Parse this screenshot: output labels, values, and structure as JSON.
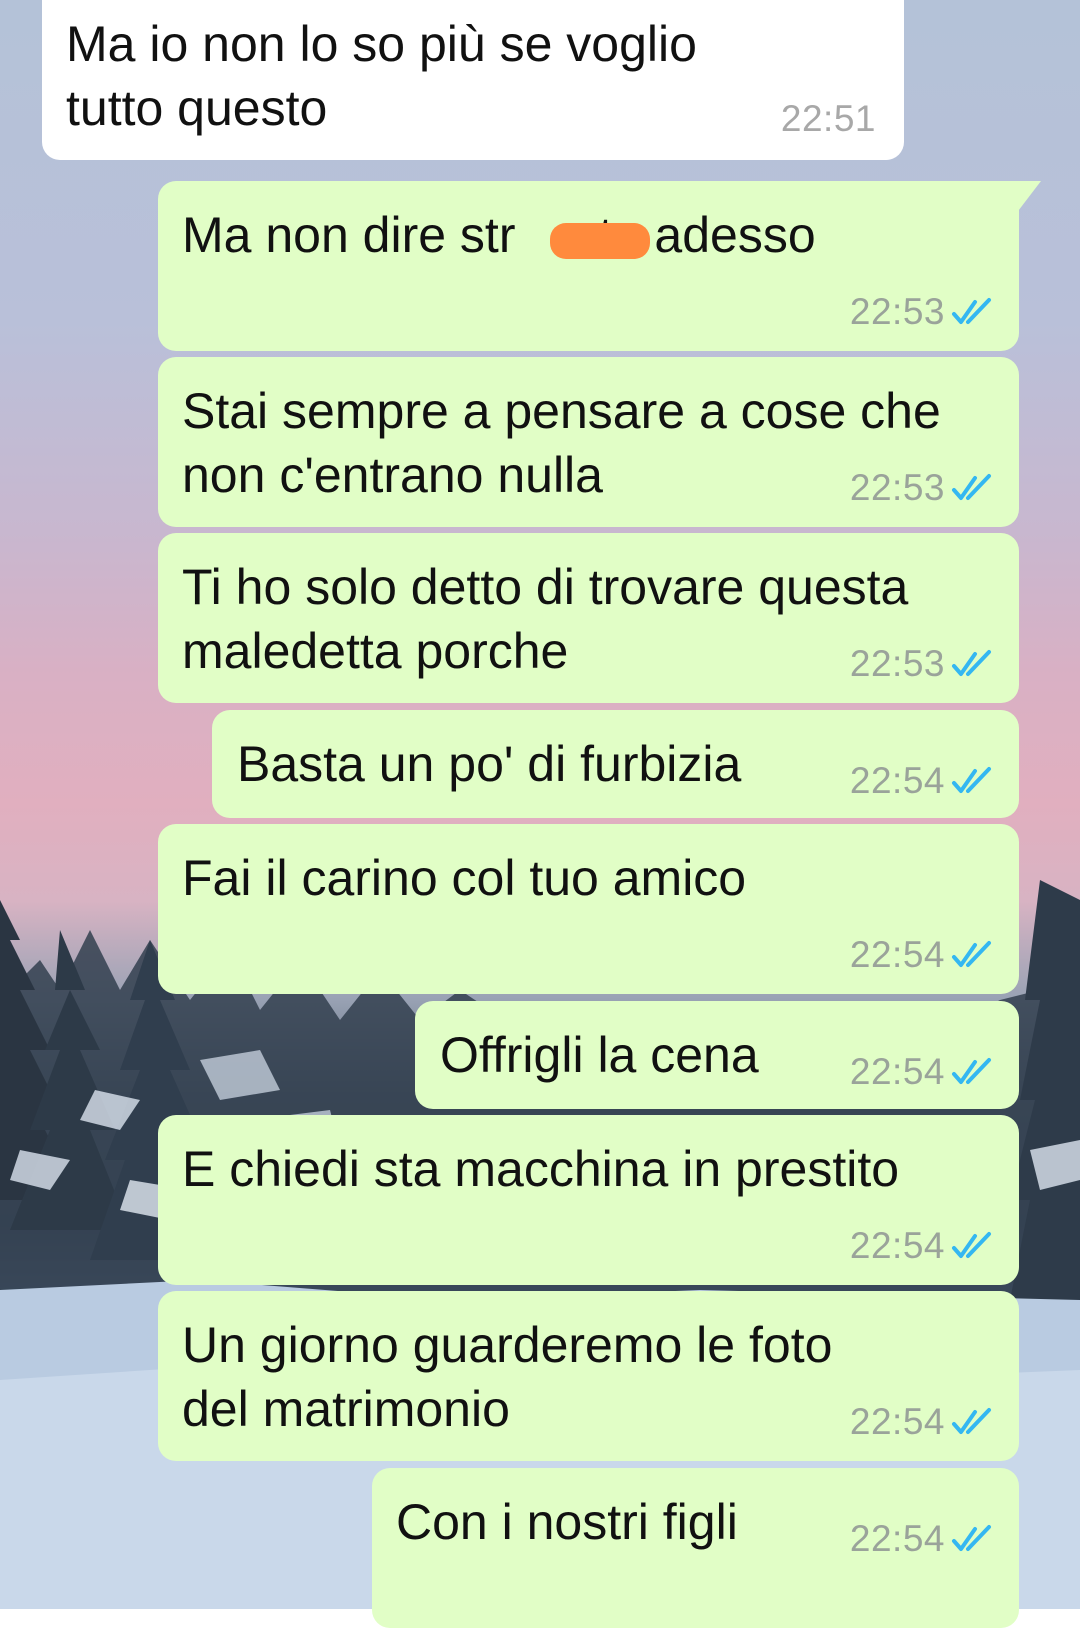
{
  "colors": {
    "incoming_bubble": "#ffffff",
    "outgoing_bubble": "#e1fec6",
    "read_ticks": "#34b7f1",
    "redaction": "#ff8a3d"
  },
  "messages": [
    {
      "direction": "incoming",
      "text": "Ma io non lo so più se voglio\ntutto questo",
      "time": "22:51"
    },
    {
      "direction": "outgoing",
      "text": "Ma non dire str    ate adesso",
      "time": "22:53",
      "status": "read-double-tick-icon",
      "redacted": true
    },
    {
      "direction": "outgoing",
      "text": "Stai sempre a pensare a cose che\nnon c'entrano nulla",
      "time": "22:53",
      "status": "read-double-tick-icon"
    },
    {
      "direction": "outgoing",
      "text": "Ti ho solo detto di trovare questa\nmaledetta porche",
      "time": "22:53",
      "status": "read-double-tick-icon"
    },
    {
      "direction": "outgoing",
      "text": "Basta un po' di furbizia",
      "time": "22:54",
      "status": "read-double-tick-icon"
    },
    {
      "direction": "outgoing",
      "text": "Fai il carino col tuo amico",
      "time": "22:54",
      "status": "read-double-tick-icon"
    },
    {
      "direction": "outgoing",
      "text": "Offrigli la cena",
      "time": "22:54",
      "status": "read-double-tick-icon"
    },
    {
      "direction": "outgoing",
      "text": "E chiedi sta macchina in prestito",
      "time": "22:54",
      "status": "read-double-tick-icon"
    },
    {
      "direction": "outgoing",
      "text": "Un giorno guarderemo le foto\ndel matrimonio",
      "time": "22:54",
      "status": "read-double-tick-icon"
    },
    {
      "direction": "outgoing",
      "text": "Con i nostri figli",
      "time": "22:54",
      "status": "read-double-tick-icon"
    }
  ]
}
